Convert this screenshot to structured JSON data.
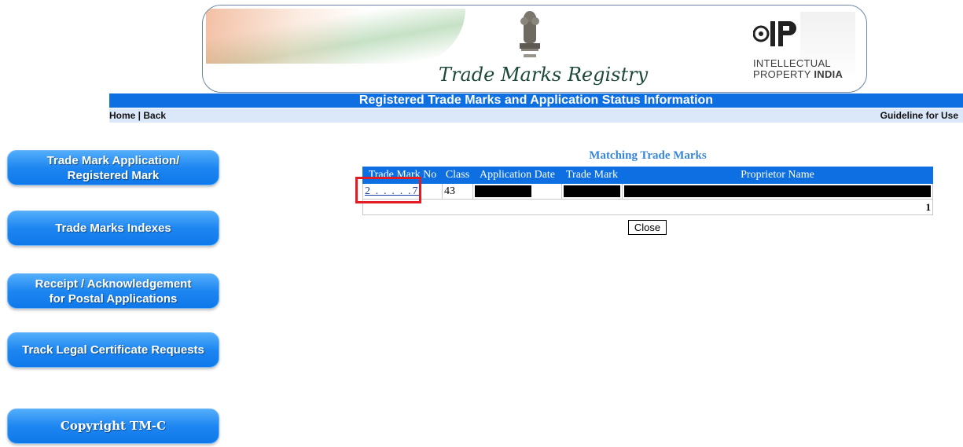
{
  "header": {
    "registry_title": "Trade Marks Registry",
    "ip_line1": "INTELLECTUAL",
    "ip_line2_a": "PROPERTY ",
    "ip_line2_b": "INDIA"
  },
  "titlebar": {
    "text": "Registered Trade Marks and Application Status Information"
  },
  "nav": {
    "home": "Home",
    "separator": " | ",
    "back": "Back",
    "guideline": "Guideline for Use"
  },
  "sidebar": {
    "items": [
      {
        "line1": "Trade Mark Application/",
        "line2": "Registered Mark"
      },
      {
        "line1": "Trade Marks Indexes"
      },
      {
        "line1": "Receipt / Acknowledgement",
        "line2": "for Postal Applications"
      },
      {
        "line1": "Track Legal Certificate Requests"
      },
      {
        "line1": "Copyright TM-C"
      }
    ]
  },
  "results": {
    "title": "Matching Trade Marks",
    "headers": [
      "Trade Mark No",
      "Class",
      "Application Date",
      "Trade Mark",
      "Proprietor Name"
    ],
    "rows": [
      {
        "tm_no": "2 . . . . .7",
        "class": "43"
      }
    ],
    "page_number": "1",
    "close_label": "Close"
  },
  "colors": {
    "primary_blue": "#0d6fe1",
    "nav_bg": "#dbe8fa",
    "highlight_red": "#e21b24"
  }
}
